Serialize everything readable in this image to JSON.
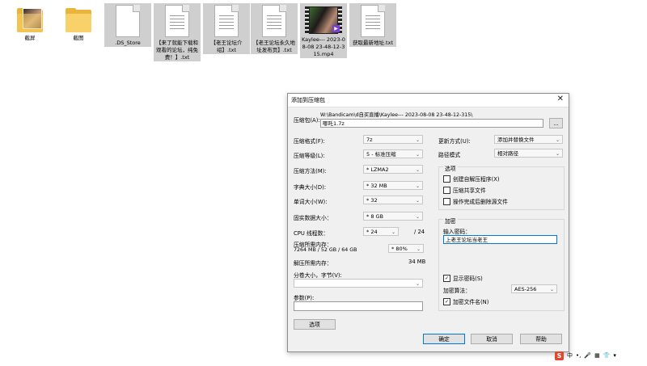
{
  "desktop": {
    "files": [
      {
        "name": "截屏",
        "kind": "folder-photo"
      },
      {
        "name": "截图",
        "kind": "folder"
      },
      {
        "name": ".DS_Store",
        "kind": "doc"
      },
      {
        "name": "【来了就能下载和观看的论坛，纯免费！】.txt",
        "kind": "doc"
      },
      {
        "name": "【老王论坛介绍】.txt",
        "kind": "doc"
      },
      {
        "name": "【老王论坛永久地址发布页】.txt",
        "kind": "doc"
      },
      {
        "name": "Kaylee--- 2023-08-08 23-48-12-315.mp4",
        "kind": "video"
      },
      {
        "name": "获取最新地址.txt",
        "kind": "doc"
      }
    ]
  },
  "dialog": {
    "title": "添加到压缩包",
    "archive_label": "压缩包(A):",
    "archive_path": "W:\\Bandicam\\d自买直播\\Kaylee--- 2023-08-08 23-48-12-315\\",
    "archive_name": "哪吒1.7z",
    "browse_label": "...",
    "format_label": "压缩格式(F):",
    "format_value": "7z",
    "level_label": "压缩等级(L):",
    "level_value": "5 - 标准压缩",
    "method_label": "压缩方法(M):",
    "method_value": "* LZMA2",
    "dict_label": "字典大小(D):",
    "dict_value": "* 32 MB",
    "word_label": "单词大小(W):",
    "word_value": "* 32",
    "solid_label": "固实数据大小：",
    "solid_value": "* 8 GB",
    "cpu_label": "CPU 线程数：",
    "cpu_value": "* 24",
    "cpu_total": "/ 24",
    "mem_label": "压缩所需内存：",
    "mem_detail": "7264 MB / 52 GB / 64 GB",
    "mem_percent": "* 80%",
    "decomp_label": "解压所需内存：",
    "decomp_value": "34 MB",
    "split_label": "分卷大小，字节(V):",
    "params_label": "参数(P):",
    "options_button": "选项",
    "update_label": "更新方式(U):",
    "update_value": "添加并替换文件",
    "path_label": "路径模式",
    "path_value": "相对路径",
    "options_group": "选项",
    "opt_sfx": "创建自解压程序(X)",
    "opt_shared": "压缩共享文件",
    "opt_delete": "操作完成后删除源文件",
    "encrypt_group": "加密",
    "password_label": "输入密码：",
    "password_value": "上老王论坛当老王",
    "show_password": "显示密码(S)",
    "enc_method_label": "加密算法：",
    "enc_method_value": "AES-256",
    "encrypt_names": "加密文件名(N)",
    "ok": "确定",
    "cancel": "取消",
    "help": "帮助"
  },
  "tray": {
    "ime_logo": "S",
    "ime_lang": "中",
    "ime_punct": "•,",
    "mic": "🎤",
    "grid": "▦",
    "shirt": "👕",
    "extra": "▾"
  }
}
